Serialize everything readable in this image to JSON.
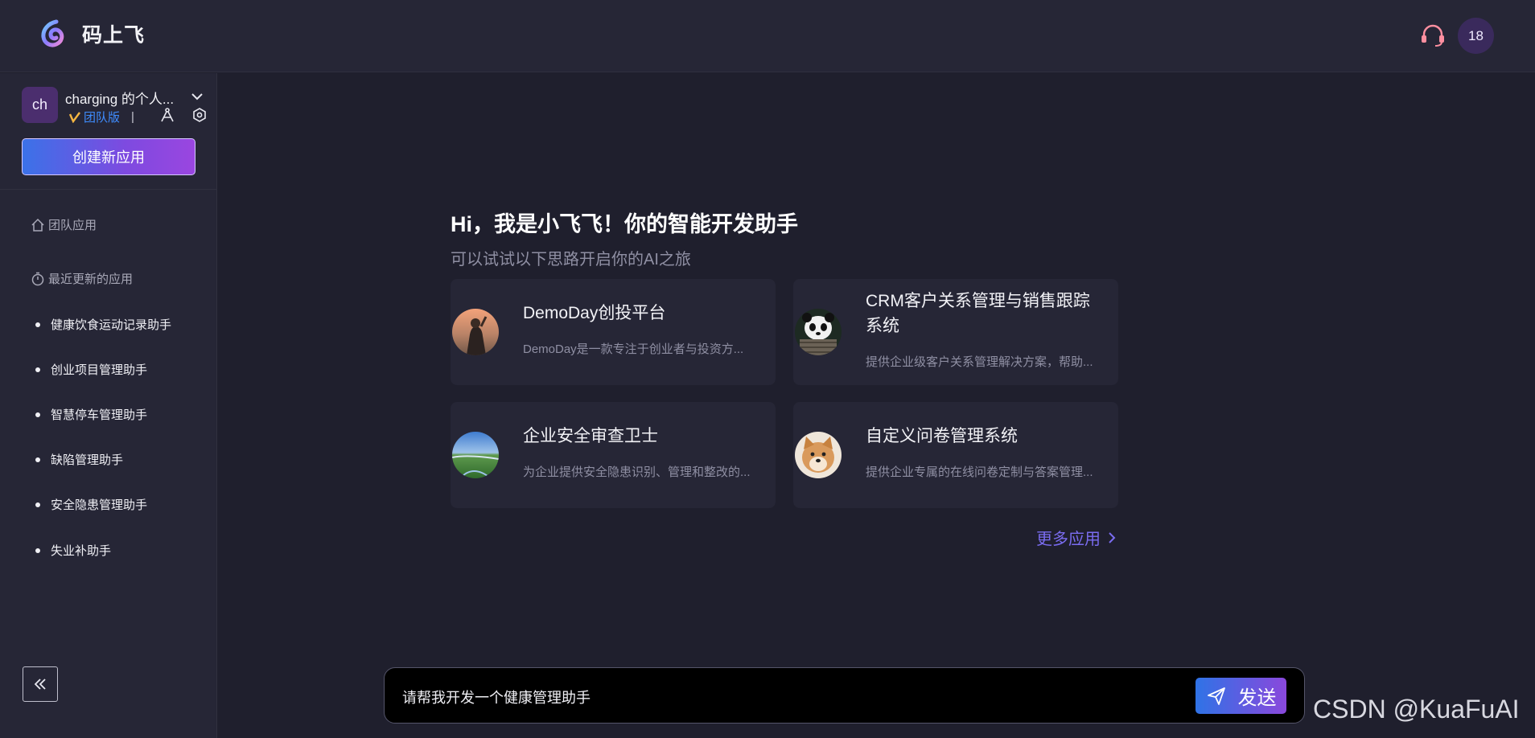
{
  "header": {
    "app_name": "码上飞",
    "support_icon": "headset-icon",
    "user_avatar_text": "18"
  },
  "sidebar": {
    "workspace": {
      "avatar_text": "ch",
      "name": "charging 的个人...",
      "plan_label": "团队版",
      "separator": "|"
    },
    "create_button": "创建新应用",
    "team_apps_label": "团队应用",
    "recent_label": "最近更新的应用",
    "recent_items": [
      "健康饮食运动记录助手",
      "创业项目管理助手",
      "智慧停车管理助手",
      "缺陷管理助手",
      "安全隐患管理助手",
      "失业补助手"
    ]
  },
  "main": {
    "greeting": "Hi，我是小飞飞！你的智能开发助手",
    "subtitle": "可以试试以下思路开启你的AI之旅",
    "cards": [
      {
        "title": "DemoDay创投平台",
        "desc": "DemoDay是一款专注于创业者与投资方...",
        "thumb": "person-photo"
      },
      {
        "title": "CRM客户关系管理与销售跟踪系统",
        "desc": "提供企业级客户关系管理解决方案，帮助...",
        "thumb": "panda-photo"
      },
      {
        "title": "企业安全审查卫士",
        "desc": "为企业提供安全隐患识别、管理和整改的...",
        "thumb": "landscape-photo"
      },
      {
        "title": "自定义问卷管理系统",
        "desc": "提供企业专属的在线问卷定制与答案管理...",
        "thumb": "dog-photo"
      }
    ],
    "more_link": "更多应用"
  },
  "chat": {
    "input_value": "请帮我开发一个健康管理助手",
    "send_label": "发送"
  },
  "watermark": "CSDN @KuaFuAI",
  "colors": {
    "accent_blue": "#3b72e8",
    "accent_purple": "#9a46e0",
    "background": "#1f1f2d",
    "panel": "#262636"
  }
}
